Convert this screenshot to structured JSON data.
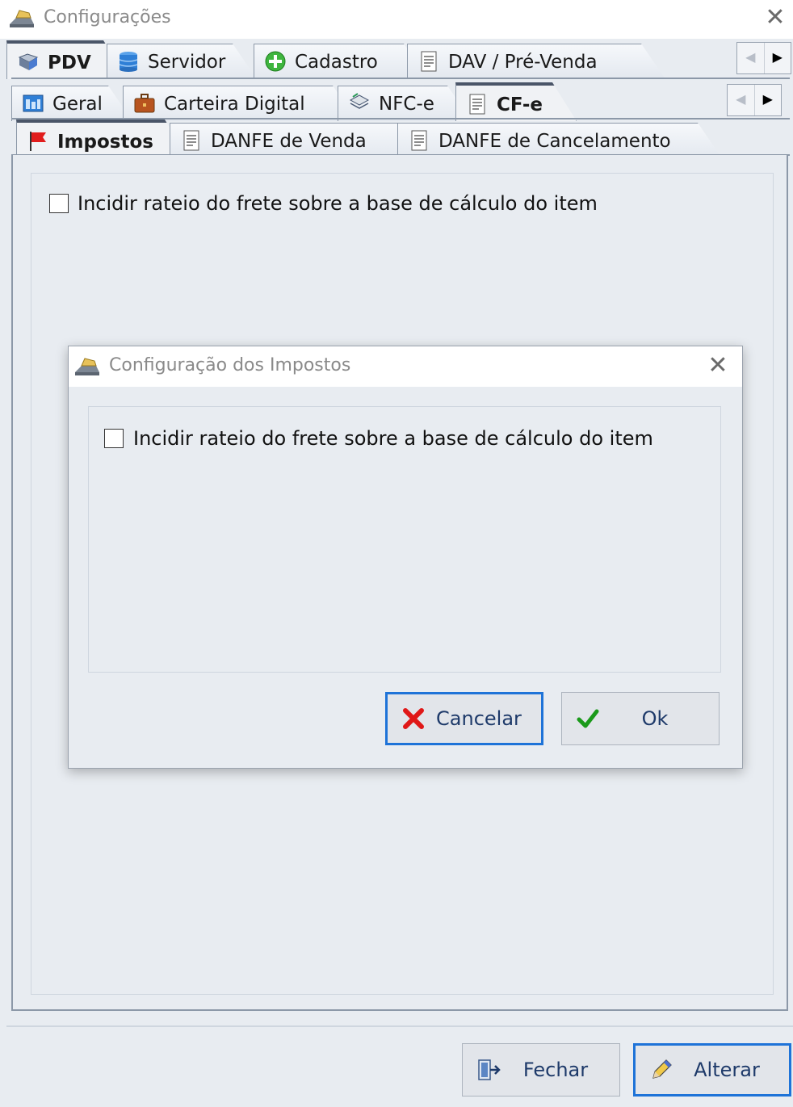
{
  "window": {
    "title": "Configurações",
    "close_icon": "close-icon"
  },
  "tabs_row1": {
    "items": [
      {
        "label": "PDV",
        "icon": "pdv-icon",
        "active": true
      },
      {
        "label": "Servidor",
        "icon": "database-icon",
        "active": false
      },
      {
        "label": "Cadastro",
        "icon": "plus-circle-icon",
        "active": false
      },
      {
        "label": "DAV / Pré-Venda",
        "icon": "document-icon",
        "active": false
      }
    ],
    "scroll_left": "◀",
    "scroll_right": "▶"
  },
  "tabs_row2": {
    "items": [
      {
        "label": "Geral",
        "icon": "settings-window-icon",
        "active": false
      },
      {
        "label": "Carteira Digital",
        "icon": "briefcase-icon",
        "active": false
      },
      {
        "label": "NFC-e",
        "icon": "nfce-icon",
        "active": false
      },
      {
        "label": "CF-e",
        "icon": "document-icon",
        "active": true
      }
    ],
    "scroll_left": "◀",
    "scroll_right": "▶"
  },
  "tabs_row3": {
    "items": [
      {
        "label": "Impostos",
        "icon": "red-flag-icon",
        "active": true
      },
      {
        "label": "DANFE de Venda",
        "icon": "document-icon",
        "active": false
      },
      {
        "label": "DANFE de Cancelamento",
        "icon": "document-icon",
        "active": false
      }
    ]
  },
  "page": {
    "checkbox_label": "Incidir rateio do frete sobre a base de cálculo do item",
    "checked": false
  },
  "dialog": {
    "title": "Configuração dos Impostos",
    "checkbox_label": "Incidir rateio do frete sobre a base de cálculo do item",
    "checked": false,
    "cancel_label": "Cancelar",
    "ok_label": "Ok"
  },
  "footer": {
    "close_label": "Fechar",
    "edit_label": "Alterar"
  },
  "colors": {
    "client_bg": "#e8ecf1",
    "tab_border": "#8c98a8",
    "focus_border": "#1e73d8",
    "button_text": "#1e3a6a",
    "cancel_red": "#e01818",
    "ok_green": "#1b9a1b"
  }
}
